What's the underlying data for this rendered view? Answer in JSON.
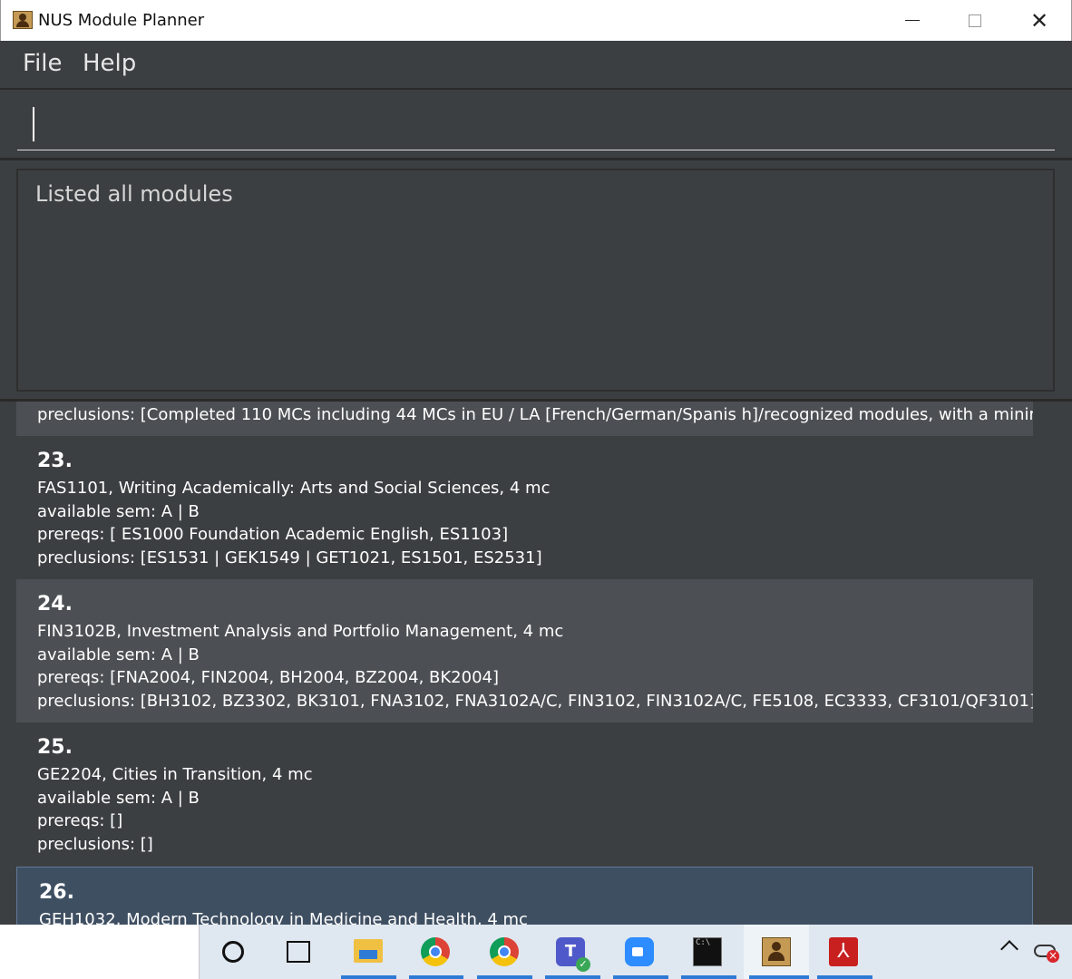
{
  "window": {
    "title": "NUS Module Planner",
    "controls": {
      "minimize": "minimize",
      "maximize": "maximize",
      "close": "✕"
    }
  },
  "menu": {
    "items": [
      "File",
      "Help"
    ]
  },
  "command": {
    "value": "",
    "placeholder": ""
  },
  "result": {
    "message": "Listed all modules"
  },
  "list": {
    "partial_line": "preclusions: [Completed 110 MCs including 44 MCs in EU / LA [French/German/Spanis h]/recognized modules, with a minim...",
    "cards": [
      {
        "index": "23.",
        "lines": [
          "FAS1101, Writing Academically: Arts and Social Sciences, 4 mc",
          "available sem: A | B",
          "prereqs: [ ES1000 Foundation Academic English, ES1103]",
          "preclusions: [ES1531 | GEK1549 | GET1021, ES1501, ES2531]"
        ]
      },
      {
        "index": "24.",
        "lines": [
          "FIN3102B, Investment Analysis and Portfolio Management, 4 mc",
          "available sem: A | B",
          "prereqs: [FNA2004, FIN2004, BH2004, BZ2004, BK2004]",
          "preclusions: [BH3102, BZ3302, BK3101, FNA3102, FNA3102A/C, FIN3102, FIN3102A/C, FE5108, EC3333, CF3101/QF3101]"
        ]
      },
      {
        "index": "25.",
        "lines": [
          "GE2204, Cities in Transition, 4 mc",
          "available sem: A | B",
          "prereqs: []",
          "preclusions: []"
        ]
      },
      {
        "index": "26.",
        "lines": [
          "GEH1032, Modern Technology in Medicine and Health, 4 mc"
        ]
      }
    ]
  },
  "taskbar": {
    "icons": [
      "cortana-icon",
      "task-view-icon",
      "file-explorer-icon",
      "chrome-icon",
      "chrome-icon",
      "teams-icon",
      "zoom-icon",
      "command-prompt-icon",
      "module-planner-icon",
      "acrobat-icon",
      "chevron-up-icon",
      "onedrive-icon"
    ],
    "cmd_glyph": "C:\\",
    "teams_glyph": "T",
    "pdf_glyph": "⅄"
  }
}
